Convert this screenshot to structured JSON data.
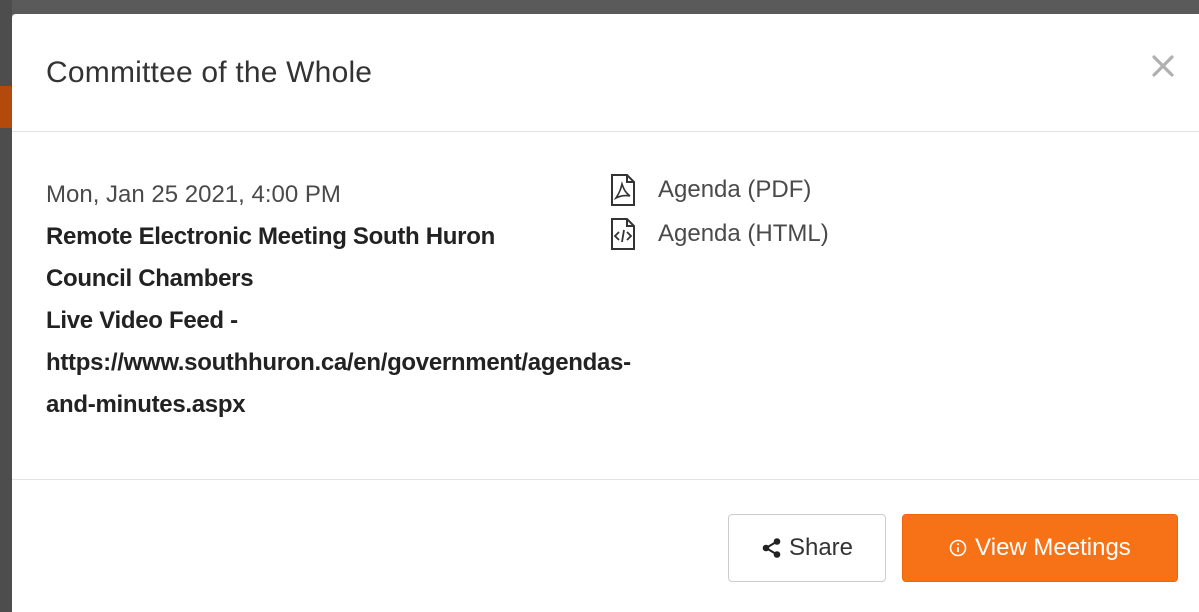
{
  "modal": {
    "title": "Committee of the Whole",
    "close_label": "×"
  },
  "meeting": {
    "date": "Mon, Jan 25 2021, 4:00 PM",
    "location_lines": [
      "Remote Electronic Meeting South Huron",
      "Council Chambers",
      "Live Video Feed -",
      "https://www.southhuron.ca/en/government/agendas-",
      "and-minutes.aspx"
    ]
  },
  "documents": [
    {
      "label": "Agenda (PDF)",
      "icon": "pdf-file-icon"
    },
    {
      "label": "Agenda (HTML)",
      "icon": "html-file-icon"
    }
  ],
  "footer": {
    "share_label": "Share",
    "share_icon": "share-icon",
    "view_label": "View Meetings",
    "view_icon": "info-circle-icon"
  },
  "colors": {
    "accent": "#f77116",
    "text": "#333333",
    "divider": "#e3e3e3"
  }
}
